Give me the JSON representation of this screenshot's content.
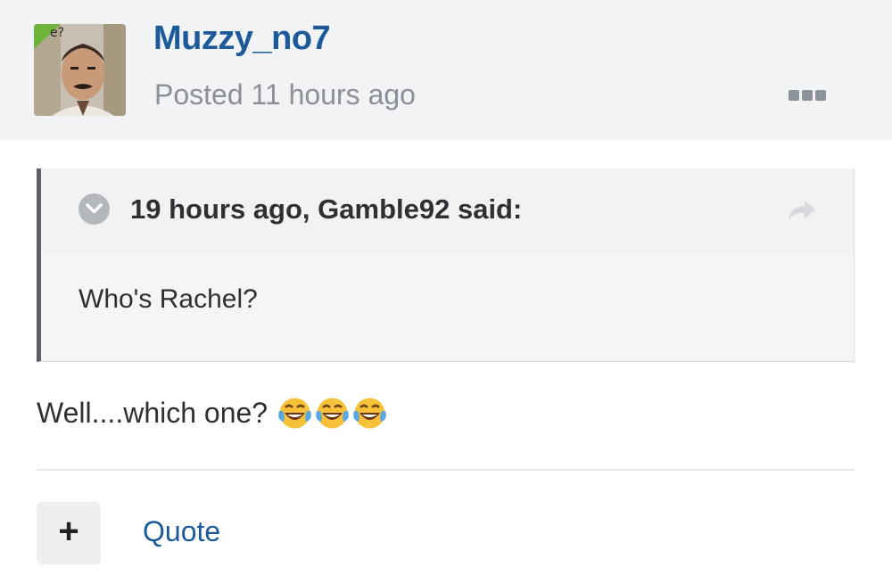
{
  "post": {
    "author": "Muzzy_no7",
    "posted": "Posted 11 hours ago",
    "avatar_caption": "e?",
    "more_icon": "ellipsis-icon"
  },
  "quote": {
    "citation": "19 hours ago, Gamble92 said:",
    "text": "Who's Rachel?",
    "toggle_icon": "chevron-down-circle-icon",
    "share_icon": "share-arrow-icon"
  },
  "body": {
    "text": "Well....which one?",
    "emojis": [
      "😂",
      "😂",
      "😂"
    ]
  },
  "actions": {
    "add_label": "+",
    "quote_label": "Quote"
  },
  "colors": {
    "username": "#1c5a99",
    "link": "#1c5a99",
    "header_bg": "#f2f3f5",
    "quote_border": "#5c5f64"
  }
}
